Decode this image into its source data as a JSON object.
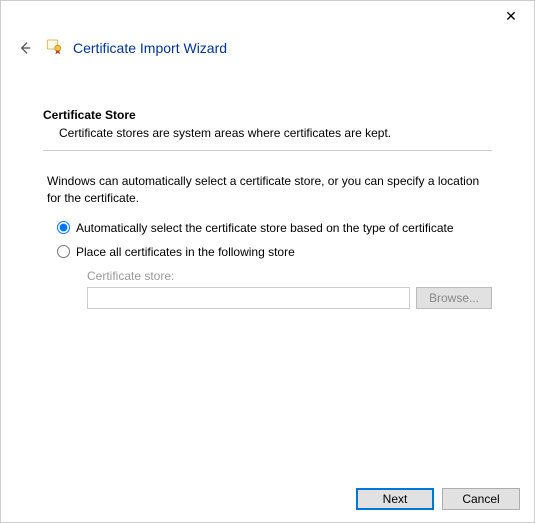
{
  "titlebar": {
    "close_label": "✕"
  },
  "header": {
    "title": "Certificate Import Wizard"
  },
  "section": {
    "heading": "Certificate Store",
    "subtext": "Certificate stores are system areas where certificates are kept."
  },
  "description": "Windows can automatically select a certificate store, or you can specify a location for the certificate.",
  "options": {
    "auto": "Automatically select the certificate store based on the type of certificate",
    "manual": "Place all certificates in the following store"
  },
  "store": {
    "label": "Certificate store:",
    "value": "",
    "browse": "Browse..."
  },
  "footer": {
    "next": "Next",
    "cancel": "Cancel"
  }
}
